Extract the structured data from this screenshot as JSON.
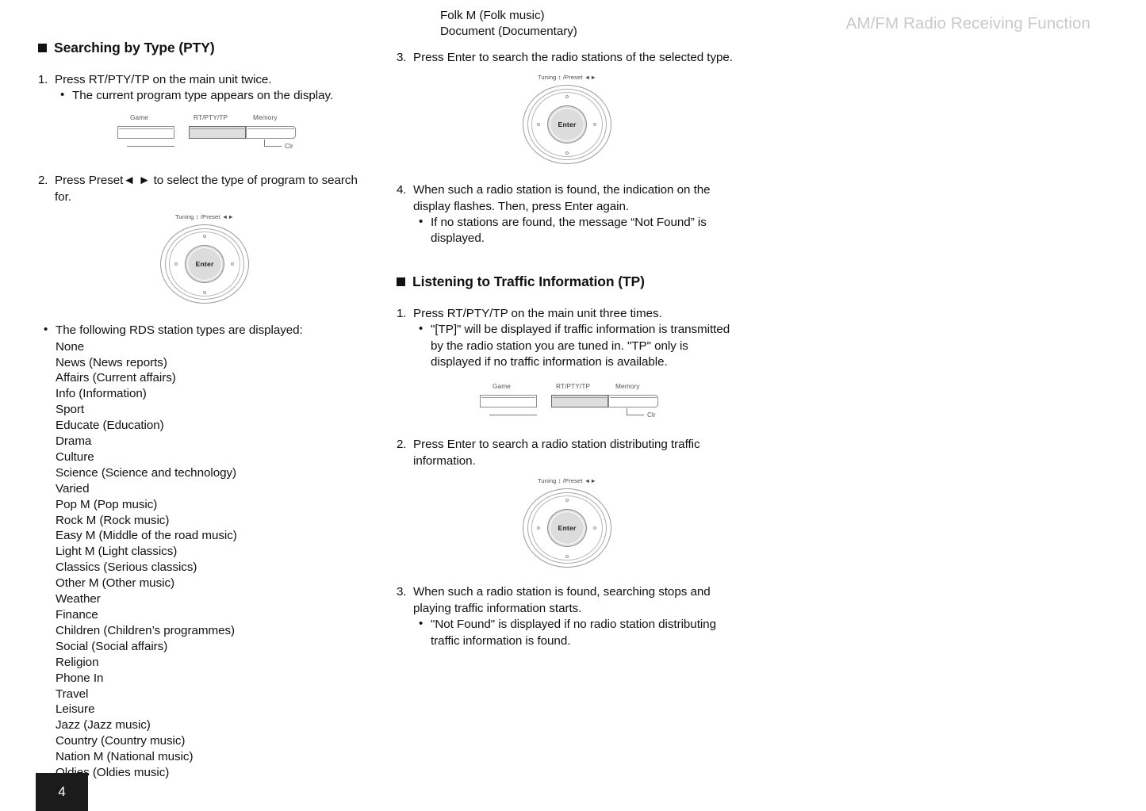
{
  "header": {
    "running_title": "AM/FM Radio Receiving Function"
  },
  "page": {
    "number": "4"
  },
  "sections": [
    {
      "id": "pty",
      "heading": "Searching by Type (PTY)",
      "steps": [
        {
          "number": "1.",
          "text": "Press RT/PTY/TP on the main unit twice.",
          "bullets": [
            "The current program type appears on the display."
          ]
        },
        {
          "number": "2.",
          "text": "Press Preset◄ ► to select the type of program to search for."
        },
        {
          "number": "3.",
          "text": "Press Enter to search the radio stations of the selected type."
        },
        {
          "number": "4.",
          "text": "When such a radio station is found, the indication on the display flashes. Then, press Enter again.",
          "bullets": [
            "If no stations are found, the message “Not Found” is displayed."
          ]
        }
      ]
    },
    {
      "id": "tp",
      "heading": "Listening to Traffic Information (TP)",
      "steps": [
        {
          "number": "1.",
          "text": "Press RT/PTY/TP on the main unit three times.",
          "bullets": [
            "\"[TP]\" will be displayed if traffic information is transmitted by the radio station you are tuned in. \"TP\" only is displayed if no traffic information is available."
          ]
        },
        {
          "number": "2.",
          "text": "Press Enter to search a radio station distributing traffic information."
        },
        {
          "number": "3.",
          "text": "When such a radio station is found, searching stops and playing traffic information starts.",
          "bullets": [
            "\"Not Found\" is displayed if no radio station distributing traffic information is found."
          ]
        }
      ]
    }
  ],
  "rds_list": {
    "intro": "The following RDS station types are displayed:",
    "types": [
      "None",
      "News (News reports)",
      "Affairs (Current affairs)",
      "Info (Information)",
      "Sport",
      "Educate (Education)",
      "Drama",
      "Culture",
      "Science (Science and technology)",
      "Varied",
      "Pop M (Pop music)",
      "Rock M (Rock music)",
      "Easy M (Middle of the road music)",
      "Light M (Light classics)",
      "Classics (Serious classics)",
      "Other M (Other music)",
      "Weather",
      "Finance",
      "Children (Children’s programmes)",
      "Social (Social affairs)",
      "Religion",
      "Phone In",
      "Travel",
      "Leisure",
      "Jazz (Jazz music)",
      "Country (Country music)",
      "Nation M (National music)",
      "Oldies (Oldies music)"
    ],
    "types_continued": [
      "Folk M (Folk music)",
      "Document (Documentary)"
    ]
  },
  "figures": {
    "button_strip": {
      "labels": {
        "game": "Game",
        "rt_pty_tp": "RT/PTY/TP",
        "memory": "Memory",
        "clr": "Clr"
      }
    },
    "jog_dial": {
      "label": "Tuning ↕ /Preset ◄►",
      "enter_label": "Enter"
    }
  },
  "colors": {
    "text": "#111111",
    "header_gray": "#c9c9c9",
    "page_tab_bg": "#1b1b1b",
    "highlight_button": "#dedede"
  }
}
